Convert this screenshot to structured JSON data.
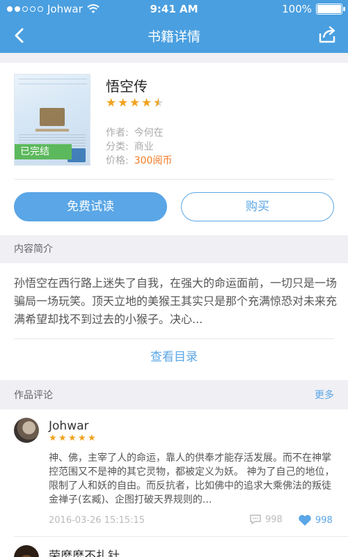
{
  "status_bar": {
    "carrier": "Johwar",
    "time": "9:41 AM",
    "battery": "100%",
    "signal_bars": 2,
    "battery_level": 1.0,
    "icons": [
      "signal-dots-icon",
      "wifi-icon",
      "battery-icon"
    ]
  },
  "nav": {
    "title": "书籍详情",
    "back_icon": "back-chevron-icon",
    "share_icon": "share-icon"
  },
  "book": {
    "title": "悟空传",
    "rating": 4.5,
    "max_rating": 5,
    "status_badge": "已完结",
    "author_label": "作者:",
    "author": "今何在",
    "category_label": "分类:",
    "category": "商业",
    "price_label": "价格:",
    "price": "300阅币"
  },
  "actions": {
    "read_label": "免费试读",
    "buy_label": "购买"
  },
  "intro": {
    "header": "内容简介",
    "text": "孙悟空在西行路上迷失了自我，在强大的命运面前，一切只是一场骗局一场玩笑。顶天立地的美猴王其实只是那个充满惊恐对未来充满希望却找不到过去的小猴子。决心...",
    "catalog_link": "查看目录"
  },
  "comments": {
    "header": "作品评论",
    "more": "更多",
    "items": [
      {
        "user": "Johwar",
        "rating": 5,
        "text": "神、佛，主宰了人的命运，靠人的供奉才能存活发展。而不在神掌控范围又不是神的其它灵物，都被定义为妖。 神为了自己的地位，限制了人和妖的自由。而反抗者，比如佛中的追求大乘佛法的叛徒金禅子(玄臧)、企图打破天界规则的...",
        "date": "2016-03-26 15:15:15",
        "replies": "998",
        "likes": "998"
      },
      {
        "user": "荣麽麽不扎针"
      }
    ]
  },
  "colors": {
    "primary": "#4a9fe0",
    "accent": "#5aa6e6",
    "star": "#f0a21d",
    "price": "#f07b27",
    "badge": "#5cb85c"
  }
}
